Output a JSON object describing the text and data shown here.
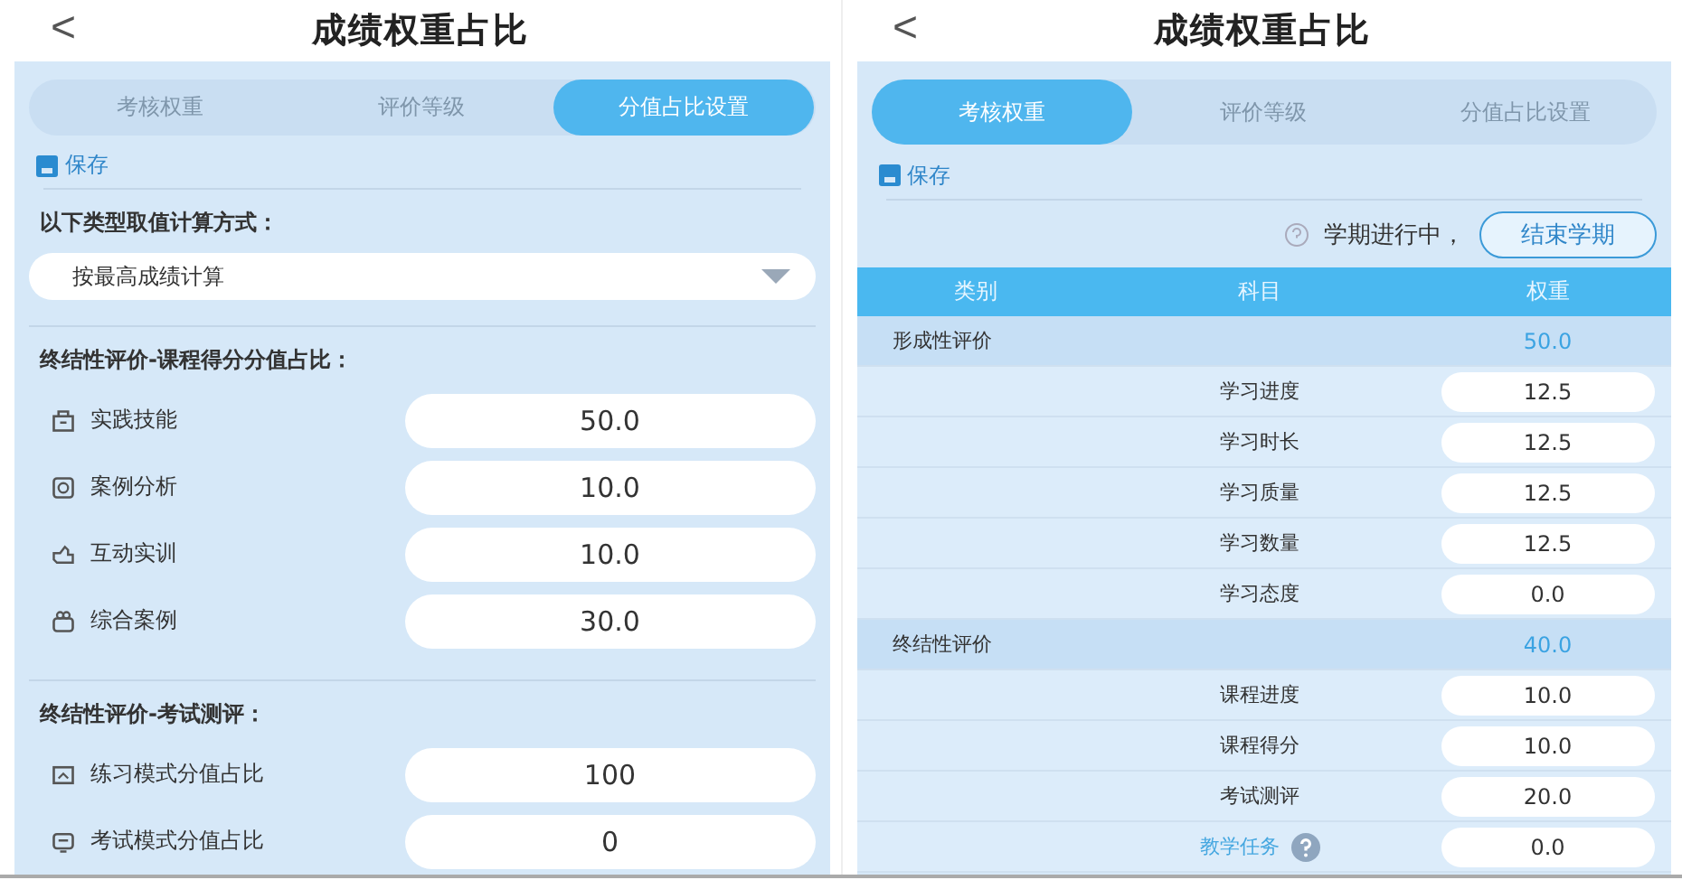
{
  "screens": [
    {
      "kind": "ratio",
      "title": "成绩权重占比",
      "back": "<",
      "tabs": [
        {
          "label": "考核权重",
          "selected": false
        },
        {
          "label": "评价等级",
          "selected": false
        },
        {
          "label": "分值占比设置",
          "selected": true
        }
      ],
      "save": "保存",
      "calc_label": "以下类型取值计算方式：",
      "calc_value": "按最高成绩计算",
      "sections": [
        {
          "heading": "终结性评价-课程得分分值占比：",
          "items": [
            {
              "label": "实践技能",
              "value": "50.0"
            },
            {
              "label": "案例分析",
              "value": "10.0"
            },
            {
              "label": "互动实训",
              "value": "10.0"
            },
            {
              "label": "综合案例",
              "value": "30.0"
            }
          ]
        },
        {
          "heading": "终结性评价-考试测评：",
          "items": [
            {
              "label": "练习模式分值占比",
              "value": "100"
            },
            {
              "label": "考试模式分值占比",
              "value": "0"
            }
          ]
        }
      ]
    },
    {
      "kind": "weights",
      "title": "成绩权重占比",
      "back": "<",
      "tabs": [
        {
          "label": "考核权重",
          "selected": true
        },
        {
          "label": "评价等级",
          "selected": false
        },
        {
          "label": "分值占比设置",
          "selected": false
        }
      ],
      "save": "保存",
      "status": "学期进行中，",
      "end_button": "结束学期",
      "columns": [
        "类别",
        "科目",
        "权重"
      ],
      "groups": [
        {
          "category": "形成性评价",
          "weight": "50.0",
          "children": [
            {
              "subject": "学习进度",
              "value": "12.5",
              "kind": "plain"
            },
            {
              "subject": "学习时长",
              "value": "12.5",
              "kind": "plain"
            },
            {
              "subject": "学习质量",
              "value": "12.5",
              "kind": "plain"
            },
            {
              "subject": "学习数量",
              "value": "12.5",
              "kind": "plain"
            },
            {
              "subject": "学习态度",
              "value": "0.0",
              "kind": "plain"
            }
          ]
        },
        {
          "category": "终结性评价",
          "weight": "40.0",
          "children": [
            {
              "subject": "课程进度",
              "value": "10.0",
              "kind": "plain"
            },
            {
              "subject": "课程得分",
              "value": "10.0",
              "kind": "plain"
            },
            {
              "subject": "考试测评",
              "value": "20.0",
              "kind": "plain"
            },
            {
              "subject": "教学任务",
              "value": "0.0",
              "kind": "help"
            }
          ]
        }
      ]
    }
  ]
}
